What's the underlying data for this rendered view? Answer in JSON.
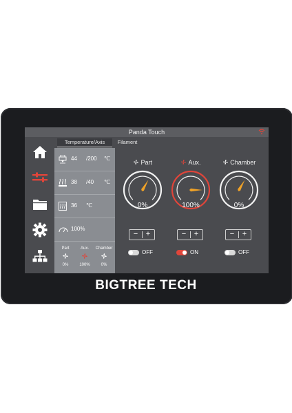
{
  "window": {
    "title": "Panda Touch"
  },
  "brand": {
    "logo_text": "BIGTREE TECH"
  },
  "tabs": [
    {
      "label": "Temperature/Axis",
      "active": true
    },
    {
      "label": "Filament",
      "active": false
    }
  ],
  "temps": {
    "nozzle": {
      "current": "44",
      "target": "/200",
      "unit": "℃"
    },
    "bed": {
      "current": "38",
      "target": "/40",
      "unit": "℃"
    },
    "chamber": {
      "current": "36",
      "unit": "℃"
    },
    "speed": {
      "value": "100%"
    }
  },
  "fans_summary": [
    {
      "name": "Part",
      "value": "0%"
    },
    {
      "name": "Aux.",
      "value": "100%"
    },
    {
      "name": "Chamber",
      "value": "0%"
    }
  ],
  "fans": [
    {
      "name": "Part",
      "percent": "0%",
      "state": "OFF",
      "level": 0,
      "on": false
    },
    {
      "name": "Aux.",
      "percent": "100%",
      "state": "ON",
      "level": 1,
      "on": true
    },
    {
      "name": "Chamber",
      "percent": "0%",
      "state": "OFF",
      "level": 0,
      "on": false
    }
  ],
  "stepper": {
    "minus": "−",
    "plus": "+"
  },
  "colors": {
    "accent": "#e0453a",
    "gauge_needle": "#f0a227",
    "panel": "#8a8d92",
    "screen_bg": "#4a4b4f"
  },
  "icons": [
    "home-icon",
    "controls-icon",
    "folder-icon",
    "gear-icon",
    "network-icon",
    "wifi-icon",
    "fan-icon",
    "nozzle-icon",
    "bed-icon",
    "chamber-icon",
    "speed-icon"
  ]
}
